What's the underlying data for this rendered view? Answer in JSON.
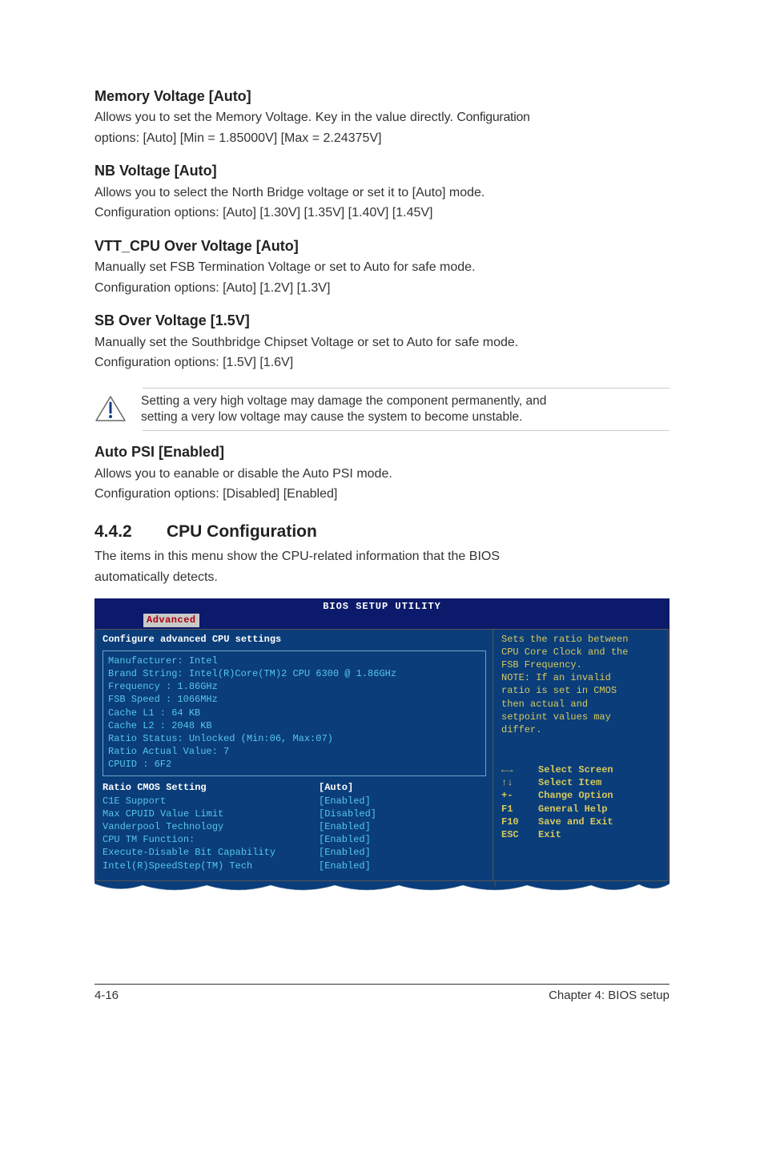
{
  "sections": {
    "memory_voltage": {
      "heading": "Memory Voltage [Auto]",
      "desc1a": "Allows you to set the Memory Voltage. Key in the value directly. ",
      "desc1b": "Configuration",
      "desc2": "options: [Auto] [Min = 1.85000V] [Max = 2.24375V]"
    },
    "nb_voltage": {
      "heading": "NB Voltage [Auto]",
      "desc1": "Allows you to select the North Bridge voltage or set it to [Auto] mode.",
      "desc2": "Configuration options: [Auto] [1.30V] [1.35V] [1.40V] [1.45V]"
    },
    "vtt_cpu": {
      "heading": "VTT_CPU Over Voltage [Auto]",
      "desc1": "Manually set FSB Termination Voltage or set to Auto for safe mode.",
      "desc2": "Configuration options: [Auto] [1.2V] [1.3V]"
    },
    "sb_over": {
      "heading": "SB Over Voltage [1.5V]",
      "desc1": "Manually set the Southbridge Chipset Voltage or set to Auto for safe mode.",
      "desc2": "Configuration options: [1.5V] [1.6V]"
    },
    "callout": {
      "line1": "Setting a very high voltage may damage the component permanently, and",
      "line2": "setting a very low voltage may cause the system to become unstable."
    },
    "auto_psi": {
      "heading": "Auto PSI [Enabled]",
      "desc1": "Allows you to eanable or disable the Auto PSI mode.",
      "desc2": "Configuration options: [Disabled] [Enabled]"
    },
    "cpu_config": {
      "num": "4.4.2",
      "title": "CPU Configuration",
      "desc1": "The items in this menu show the CPU-related information that the BIOS",
      "desc2": "automatically detects."
    }
  },
  "bios": {
    "title": "BIOS SETUP UTILITY",
    "tab": "Advanced",
    "left_heading": "Configure advanced CPU settings",
    "info": {
      "l1": "Manufacturer: Intel",
      "l2": "Brand String: Intel(R)Core(TM)2 CPU 6300 @ 1.86GHz",
      "l3": "Frequency   : 1.86GHz",
      "l4": "FSB Speed   : 1066MHz",
      "l5": "Cache L1    : 64 KB",
      "l6": "Cache L2    : 2048 KB",
      "l7": "Ratio Status: Unlocked (Min:06, Max:07)",
      "l8": "Ratio Actual Value: 7",
      "l9": "CPUID       : 6F2"
    },
    "settings": [
      {
        "label": "Ratio CMOS Setting",
        "value": "[Auto]",
        "hl": true
      },
      {
        "label": "C1E Support",
        "value": "[Enabled]",
        "hl": false
      },
      {
        "label": "Max CPUID Value Limit",
        "value": "[Disabled]",
        "hl": false
      },
      {
        "label": "Vanderpool Technology",
        "value": "[Enabled]",
        "hl": false
      },
      {
        "label": "CPU TM Function:",
        "value": "[Enabled]",
        "hl": false
      },
      {
        "label": "Execute-Disable Bit Capability",
        "value": "[Enabled]",
        "hl": false
      },
      {
        "label": "Intel(R)SpeedStep(TM) Tech",
        "value": "[Enabled]",
        "hl": false
      }
    ],
    "help": {
      "l1": "Sets the ratio between",
      "l2": "CPU Core Clock and the",
      "l3": "FSB Frequency.",
      "l4": "NOTE: If an invalid",
      "l5": "ratio is set in CMOS",
      "l6": "then actual and",
      "l7": "setpoint values may",
      "l8": "differ."
    },
    "nav": [
      {
        "key": "←→",
        "label": "Select Screen"
      },
      {
        "key": "↑↓",
        "label": "Select Item"
      },
      {
        "key": "+-",
        "label": "Change Option"
      },
      {
        "key": "F1",
        "label": "General Help"
      },
      {
        "key": "F10",
        "label": "Save and Exit"
      },
      {
        "key": "ESC",
        "label": "Exit"
      }
    ]
  },
  "footer": {
    "left": "4-16",
    "right": "Chapter 4: BIOS setup"
  }
}
